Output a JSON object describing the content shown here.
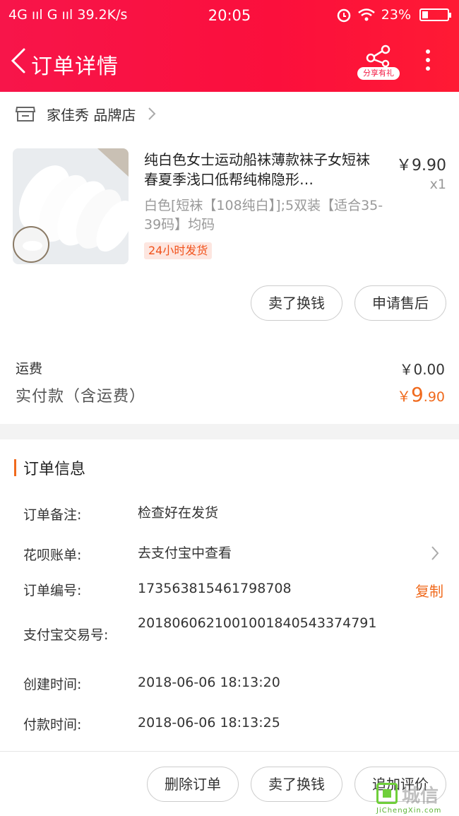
{
  "status_bar": {
    "left": "4G ııl G ııl 39.2K/s",
    "time": "20:05",
    "battery": "23%",
    "battery_level": 0.23
  },
  "nav": {
    "title": "订单详情",
    "share_label": "分享有礼"
  },
  "shop": {
    "name": "家佳秀 品牌店"
  },
  "product": {
    "title": "纯白色女士运动船袜薄款袜子女短袜春夏季浅口低帮纯棉隐形…",
    "sku": "白色[短袜【108纯白】];5双装【适合35-39码】均码",
    "tag": "24小时发货",
    "price": "￥9.90",
    "qty": "x1"
  },
  "item_actions": {
    "sell": "卖了换钱",
    "after_sale": "申请售后"
  },
  "fees": {
    "shipping_label": "运费",
    "shipping_value": "￥0.00",
    "paid_label": "实付款（含运费）",
    "paid_currency": "￥",
    "paid_int": "9",
    "paid_dec": ".90"
  },
  "order_info": {
    "section_title": "订单信息",
    "rows": [
      {
        "key": "订单备注:",
        "value": "检查好在发货"
      },
      {
        "key": "花呗账单:",
        "value": "去支付宝中查看"
      },
      {
        "key": "订单编号:",
        "value": "173563815461798708",
        "action": "复制"
      },
      {
        "key": "支付宝交易号:",
        "value": "2018060621001001840543374791"
      },
      {
        "key": "创建时间:",
        "value": "2018-06-06 18:13:20"
      },
      {
        "key": "付款时间:",
        "value": "2018-06-06 18:13:25"
      }
    ]
  },
  "bottom_actions": {
    "delete": "删除订单",
    "sell": "卖了换钱",
    "review": "追加评价"
  },
  "watermark": {
    "cn": "城信",
    "en": "JiChengXin.com"
  },
  "colors": {
    "header": "#fb0f3c",
    "accent": "#f06a1d",
    "tag_bg": "#fde6e0"
  }
}
